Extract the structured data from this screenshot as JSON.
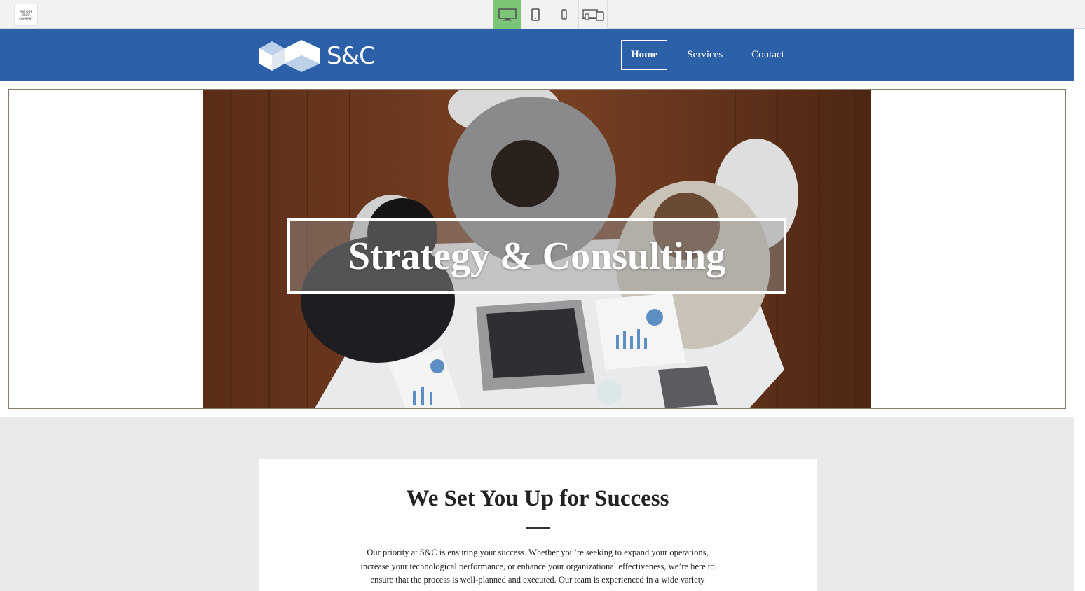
{
  "editor": {
    "logo_text": "THE WEB MEDIA COMPANY",
    "devices": [
      {
        "name": "desktop",
        "active": true
      },
      {
        "name": "tablet",
        "active": false
      },
      {
        "name": "mobile",
        "active": false
      },
      {
        "name": "responsive",
        "active": false
      }
    ],
    "active_color": "#7cc576"
  },
  "header": {
    "brand": "S&C",
    "bg_color": "#2c60a8",
    "nav": {
      "home": "Home",
      "services": "Services",
      "contact": "Contact"
    }
  },
  "hero": {
    "title": "Strategy & Consulting"
  },
  "intro": {
    "heading": "We Set You Up for Success",
    "body": "Our priority at S&C is ensuring your success. Whether you’re seeking to expand your operations, increase your technological performance, or enhance your organizational effectiveness, we’re here to ensure that the process is well-planned and executed. Our team is experienced in a wide variety"
  }
}
